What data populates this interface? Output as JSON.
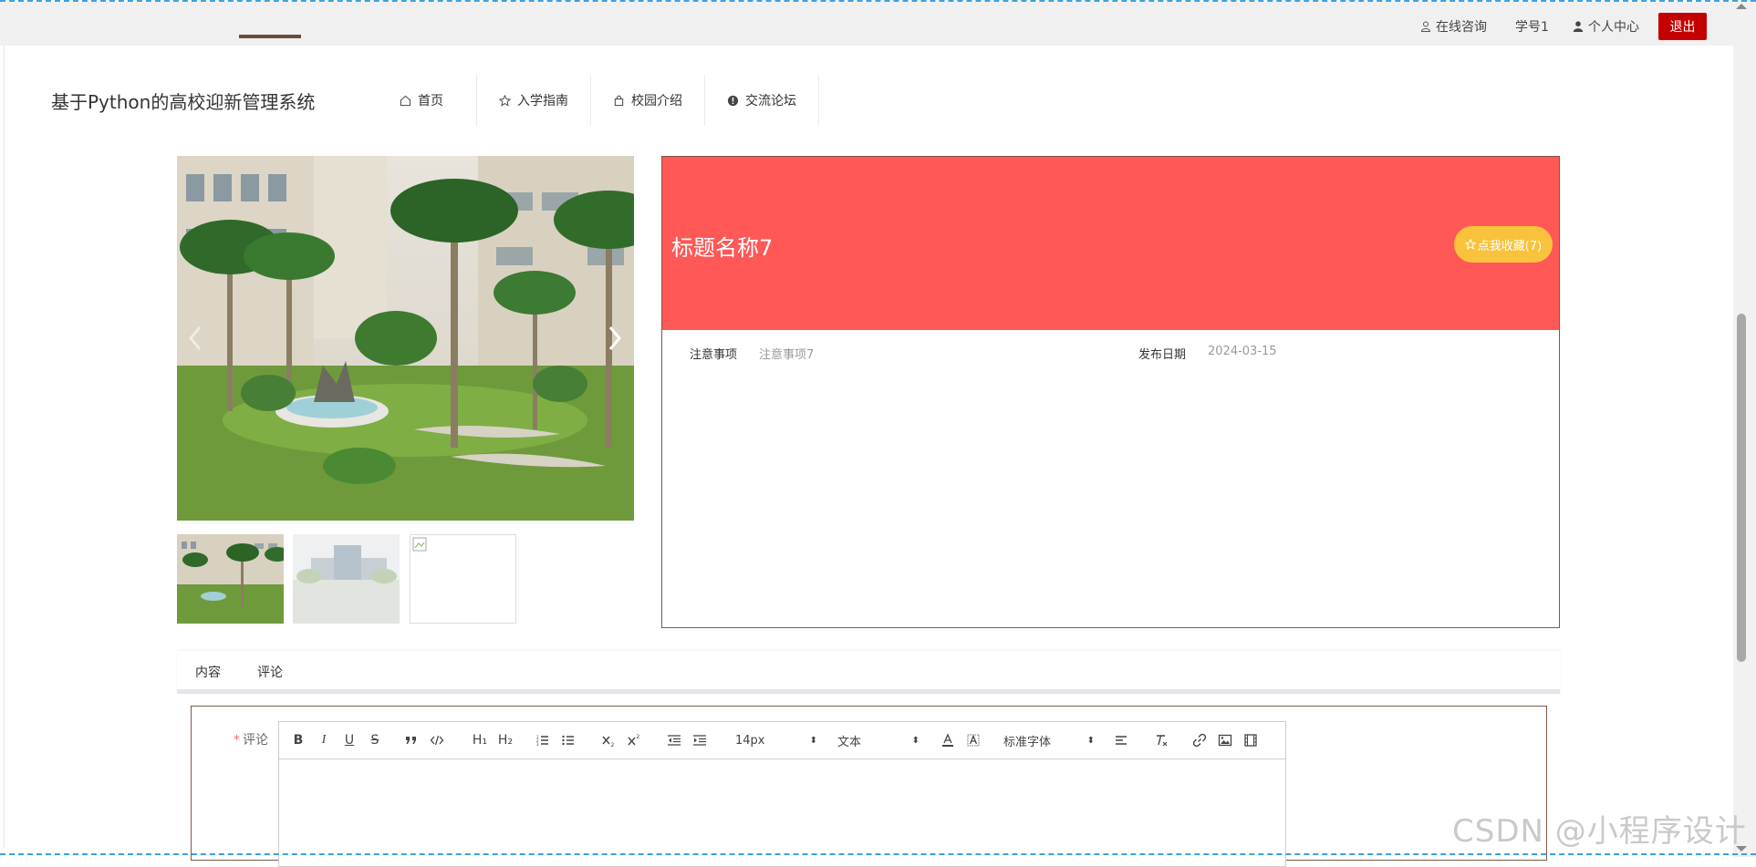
{
  "topbar": {
    "consult_label": "在线咨询",
    "user_label": "学号1",
    "center_label": "个人中心",
    "logout_label": "退出"
  },
  "header": {
    "site_title": "基于Python的高校迎新管理系统",
    "nav": [
      {
        "label": "首页",
        "icon": "home-icon"
      },
      {
        "label": "入学指南",
        "icon": "star-icon"
      },
      {
        "label": "校园介绍",
        "icon": "bag-icon"
      },
      {
        "label": "交流论坛",
        "icon": "info-icon"
      }
    ]
  },
  "gallery": {
    "thumbnails": [
      "campus-garden",
      "campus-building",
      "broken-image"
    ]
  },
  "detail": {
    "title": "标题名称7",
    "favorite_label": "点我收藏(7)",
    "notice_label": "注意事项",
    "notice_value": "注意事项7",
    "date_label": "发布日期",
    "date_value": "2024-03-15",
    "banner_color": "#ff5856",
    "favorite_color": "#f9c23c"
  },
  "tabs": [
    {
      "label": "内容",
      "active": false
    },
    {
      "label": "评论",
      "active": true
    }
  ],
  "comment": {
    "label": "评论",
    "required_mark": "*",
    "toolbar": {
      "bold": "B",
      "italic": "I",
      "underline": "U",
      "strike": "S",
      "h1": "H₁",
      "h2": "H₂",
      "font_size": "14px",
      "text_style": "文本",
      "font_family": "标准字体"
    }
  },
  "watermark": "CSDN @小程序设计"
}
